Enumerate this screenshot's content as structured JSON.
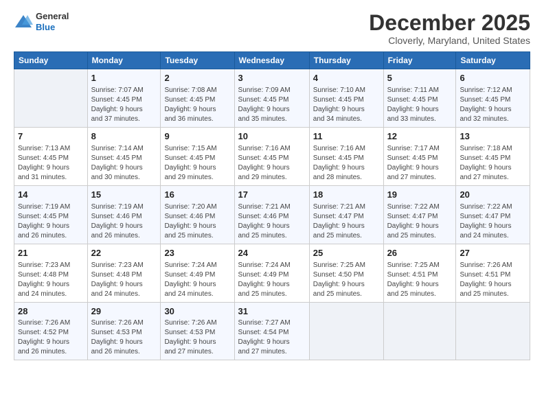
{
  "logo": {
    "general": "General",
    "blue": "Blue"
  },
  "header": {
    "month": "December 2025",
    "location": "Cloverly, Maryland, United States"
  },
  "weekdays": [
    "Sunday",
    "Monday",
    "Tuesday",
    "Wednesday",
    "Thursday",
    "Friday",
    "Saturday"
  ],
  "weeks": [
    [
      {
        "day": "",
        "content": ""
      },
      {
        "day": "1",
        "content": "Sunrise: 7:07 AM\nSunset: 4:45 PM\nDaylight: 9 hours\nand 37 minutes."
      },
      {
        "day": "2",
        "content": "Sunrise: 7:08 AM\nSunset: 4:45 PM\nDaylight: 9 hours\nand 36 minutes."
      },
      {
        "day": "3",
        "content": "Sunrise: 7:09 AM\nSunset: 4:45 PM\nDaylight: 9 hours\nand 35 minutes."
      },
      {
        "day": "4",
        "content": "Sunrise: 7:10 AM\nSunset: 4:45 PM\nDaylight: 9 hours\nand 34 minutes."
      },
      {
        "day": "5",
        "content": "Sunrise: 7:11 AM\nSunset: 4:45 PM\nDaylight: 9 hours\nand 33 minutes."
      },
      {
        "day": "6",
        "content": "Sunrise: 7:12 AM\nSunset: 4:45 PM\nDaylight: 9 hours\nand 32 minutes."
      }
    ],
    [
      {
        "day": "7",
        "content": "Sunrise: 7:13 AM\nSunset: 4:45 PM\nDaylight: 9 hours\nand 31 minutes."
      },
      {
        "day": "8",
        "content": "Sunrise: 7:14 AM\nSunset: 4:45 PM\nDaylight: 9 hours\nand 30 minutes."
      },
      {
        "day": "9",
        "content": "Sunrise: 7:15 AM\nSunset: 4:45 PM\nDaylight: 9 hours\nand 29 minutes."
      },
      {
        "day": "10",
        "content": "Sunrise: 7:16 AM\nSunset: 4:45 PM\nDaylight: 9 hours\nand 29 minutes."
      },
      {
        "day": "11",
        "content": "Sunrise: 7:16 AM\nSunset: 4:45 PM\nDaylight: 9 hours\nand 28 minutes."
      },
      {
        "day": "12",
        "content": "Sunrise: 7:17 AM\nSunset: 4:45 PM\nDaylight: 9 hours\nand 27 minutes."
      },
      {
        "day": "13",
        "content": "Sunrise: 7:18 AM\nSunset: 4:45 PM\nDaylight: 9 hours\nand 27 minutes."
      }
    ],
    [
      {
        "day": "14",
        "content": "Sunrise: 7:19 AM\nSunset: 4:45 PM\nDaylight: 9 hours\nand 26 minutes."
      },
      {
        "day": "15",
        "content": "Sunrise: 7:19 AM\nSunset: 4:46 PM\nDaylight: 9 hours\nand 26 minutes."
      },
      {
        "day": "16",
        "content": "Sunrise: 7:20 AM\nSunset: 4:46 PM\nDaylight: 9 hours\nand 25 minutes."
      },
      {
        "day": "17",
        "content": "Sunrise: 7:21 AM\nSunset: 4:46 PM\nDaylight: 9 hours\nand 25 minutes."
      },
      {
        "day": "18",
        "content": "Sunrise: 7:21 AM\nSunset: 4:47 PM\nDaylight: 9 hours\nand 25 minutes."
      },
      {
        "day": "19",
        "content": "Sunrise: 7:22 AM\nSunset: 4:47 PM\nDaylight: 9 hours\nand 25 minutes."
      },
      {
        "day": "20",
        "content": "Sunrise: 7:22 AM\nSunset: 4:47 PM\nDaylight: 9 hours\nand 24 minutes."
      }
    ],
    [
      {
        "day": "21",
        "content": "Sunrise: 7:23 AM\nSunset: 4:48 PM\nDaylight: 9 hours\nand 24 minutes."
      },
      {
        "day": "22",
        "content": "Sunrise: 7:23 AM\nSunset: 4:48 PM\nDaylight: 9 hours\nand 24 minutes."
      },
      {
        "day": "23",
        "content": "Sunrise: 7:24 AM\nSunset: 4:49 PM\nDaylight: 9 hours\nand 24 minutes."
      },
      {
        "day": "24",
        "content": "Sunrise: 7:24 AM\nSunset: 4:49 PM\nDaylight: 9 hours\nand 25 minutes."
      },
      {
        "day": "25",
        "content": "Sunrise: 7:25 AM\nSunset: 4:50 PM\nDaylight: 9 hours\nand 25 minutes."
      },
      {
        "day": "26",
        "content": "Sunrise: 7:25 AM\nSunset: 4:51 PM\nDaylight: 9 hours\nand 25 minutes."
      },
      {
        "day": "27",
        "content": "Sunrise: 7:26 AM\nSunset: 4:51 PM\nDaylight: 9 hours\nand 25 minutes."
      }
    ],
    [
      {
        "day": "28",
        "content": "Sunrise: 7:26 AM\nSunset: 4:52 PM\nDaylight: 9 hours\nand 26 minutes."
      },
      {
        "day": "29",
        "content": "Sunrise: 7:26 AM\nSunset: 4:53 PM\nDaylight: 9 hours\nand 26 minutes."
      },
      {
        "day": "30",
        "content": "Sunrise: 7:26 AM\nSunset: 4:53 PM\nDaylight: 9 hours\nand 27 minutes."
      },
      {
        "day": "31",
        "content": "Sunrise: 7:27 AM\nSunset: 4:54 PM\nDaylight: 9 hours\nand 27 minutes."
      },
      {
        "day": "",
        "content": ""
      },
      {
        "day": "",
        "content": ""
      },
      {
        "day": "",
        "content": ""
      }
    ]
  ]
}
